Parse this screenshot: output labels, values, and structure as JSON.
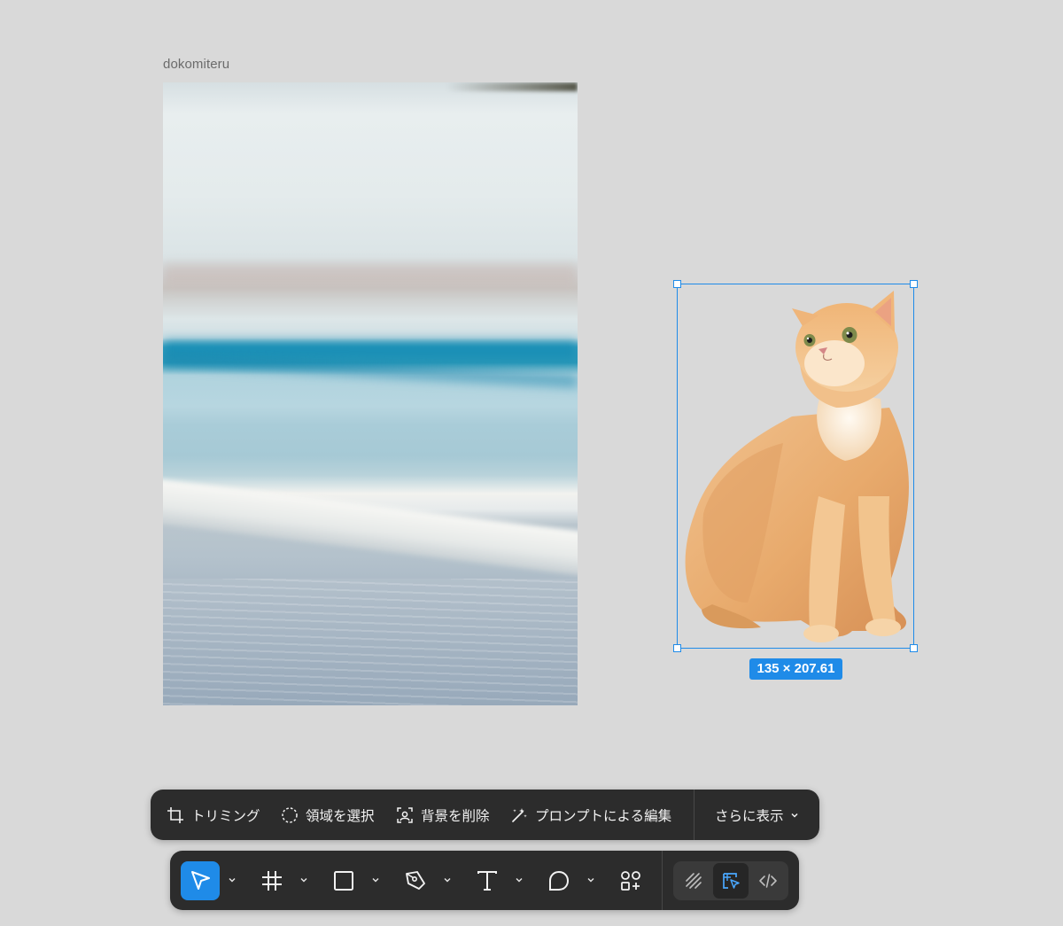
{
  "canvas": {
    "frame_label": "dokomiteru",
    "selection_size": "135 × 207.61"
  },
  "context_toolbar": {
    "items": [
      {
        "icon": "crop-icon",
        "label": "トリミング"
      },
      {
        "icon": "lasso-icon",
        "label": "領域を選択"
      },
      {
        "icon": "remove-background-icon",
        "label": "背景を削除"
      },
      {
        "icon": "magic-wand-icon",
        "label": "プロンプトによる編集"
      }
    ],
    "more": {
      "label": "さらに表示",
      "icon": "chevron-down-icon"
    }
  },
  "main_toolbar": {
    "tools": [
      {
        "name": "move-tool",
        "icon": "cursor-arrow-icon",
        "active": true
      },
      {
        "name": "frame-tool",
        "icon": "hash-frame-icon",
        "active": false
      },
      {
        "name": "shape-tool",
        "icon": "rectangle-icon",
        "active": false
      },
      {
        "name": "pen-tool",
        "icon": "pen-nib-icon",
        "active": false
      },
      {
        "name": "text-tool",
        "icon": "text-t-icon",
        "active": false
      },
      {
        "name": "comment-tool",
        "icon": "speech-bubble-icon",
        "active": false
      },
      {
        "name": "assets-tool",
        "icon": "components-icon",
        "active": false
      }
    ],
    "modes": [
      {
        "name": "draw-mode",
        "icon": "scribble-icon",
        "selected": false
      },
      {
        "name": "design-mode",
        "icon": "design-cursor-icon",
        "selected": true
      },
      {
        "name": "dev-mode",
        "icon": "code-brackets-icon",
        "selected": false
      }
    ]
  },
  "colors": {
    "canvas": "#d9d9d9",
    "toolbar": "#2c2c2c",
    "accent": "#1f8be8"
  }
}
